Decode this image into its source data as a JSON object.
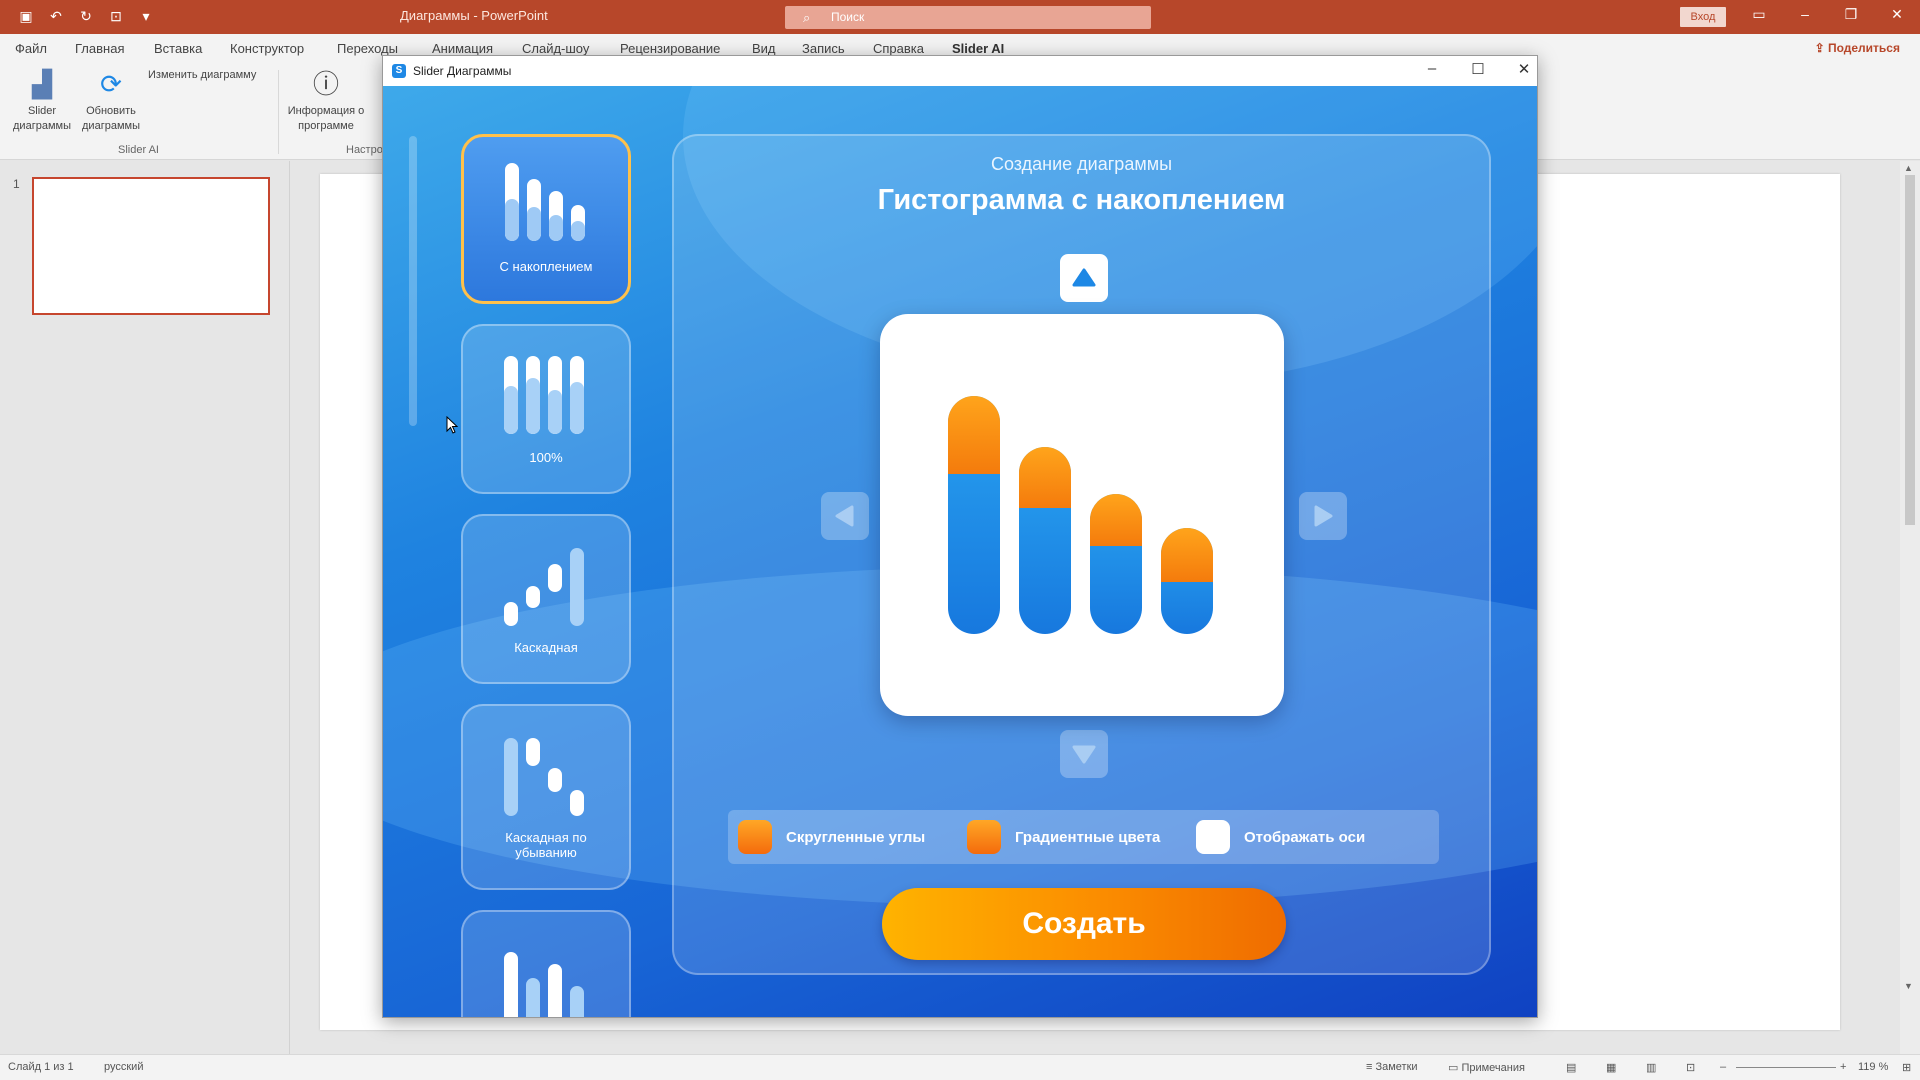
{
  "app": {
    "title": "Диаграммы  -  PowerPoint",
    "search_placeholder": "Поиск",
    "signin": "Вход",
    "share": "Поделиться"
  },
  "menu": [
    "Файл",
    "Главная",
    "Вставка",
    "Конструктор",
    "Переходы",
    "Анимация",
    "Слайд-шоу",
    "Рецензирование",
    "Вид",
    "Запись",
    "Справка",
    "Slider AI"
  ],
  "ribbon": {
    "slider_charts": "Slider диаграммы",
    "refresh_charts": "Обновить диаграммы",
    "edit_chart": "Изменить диаграмму",
    "about": "Информация о программе",
    "group_label": "Slider AI",
    "group2_label": "Настро"
  },
  "slides": {
    "number": "1"
  },
  "statusbar": {
    "slide_info": "Слайд 1 из 1",
    "language": "русский",
    "notes": "Заметки",
    "comments": "Примечания",
    "zoom": "119 %"
  },
  "dialog": {
    "title": "Slider Диаграммы",
    "subtitle": "Создание диаграммы",
    "heading": "Гистограмма с накоплением",
    "cards": [
      {
        "label": "С накоплением",
        "selected": true
      },
      {
        "label": "100%",
        "selected": false
      },
      {
        "label": "Каскадная",
        "selected": false
      },
      {
        "label": "Каскадная по убыванию",
        "selected": false
      }
    ],
    "options": [
      {
        "label": "Скругленные углы",
        "checked": true
      },
      {
        "label": "Градиентные цвета",
        "checked": true
      },
      {
        "label": "Отображать оси",
        "checked": false
      }
    ],
    "create_button": "Создать",
    "accent_orange": "#fb8c00",
    "accent_blue": "#1e88e5"
  }
}
